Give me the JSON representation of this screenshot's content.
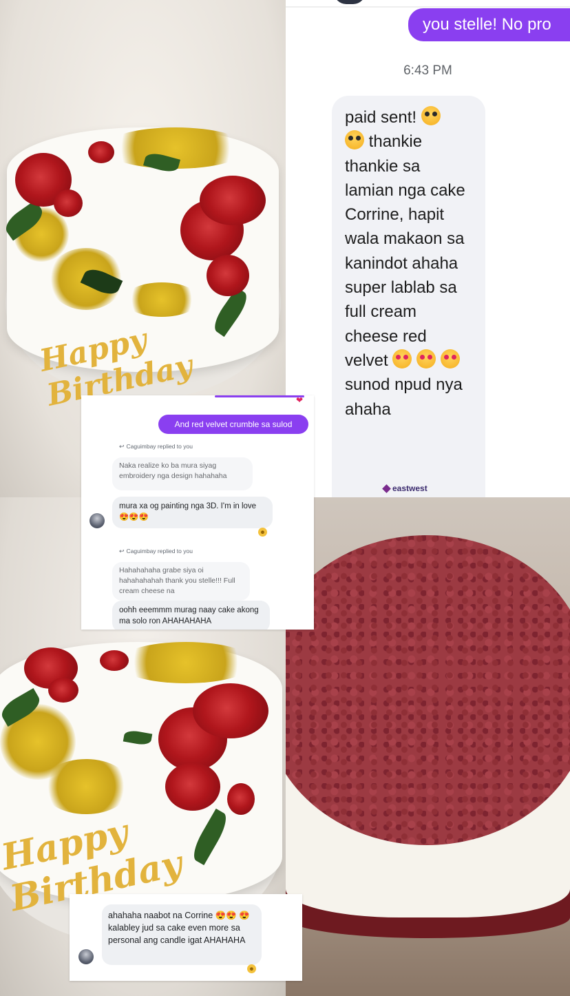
{
  "chat_main": {
    "outgoing_text": "you stelle! No pro",
    "timestamp": "6:43 PM",
    "incoming_text_line1": "paid sent!",
    "incoming_text_line2": "thankie",
    "incoming_text_rest": "thankie sa lamian nga cake Corrine, hapit wala makaon sa kanindot ahaha super lablab sa full cream cheese red velvet",
    "incoming_text_tail1": "sunod",
    "incoming_text_tail2": "npud nya ahaha",
    "emoji_starstruck": "star-struck-emoji",
    "emoji_hearteyes": "heart-eyes-emoji",
    "bank_logo": "eastwest",
    "accent_color": "#8a3ff0"
  },
  "card1": {
    "outgoing_text": "And red velvet crumble sa sulod",
    "reply_note_1": "Caguimbay replied to you",
    "quoted_1": "Naka realize ko ba mura siyag embroidery nga design hahahaha",
    "message_1": "mura xa og painting nga 3D. I'm in love 😍😍😍",
    "reply_note_2": "Caguimbay replied to you",
    "quoted_2": "Hahahahaha grabe siya oi hahahahahah thank you stelle!!! Full cream cheese na",
    "message_2": "oohh eeemmm murag naay cake akong ma solo ron AHAHAHAHA"
  },
  "card2": {
    "message": "ahahaha naabot na Corrine 😍😍 😍 kalabley jud sa cake even more sa personal ang candle igat AHAHAHA"
  },
  "photos": {
    "topper_text": "Happy Birthday"
  }
}
